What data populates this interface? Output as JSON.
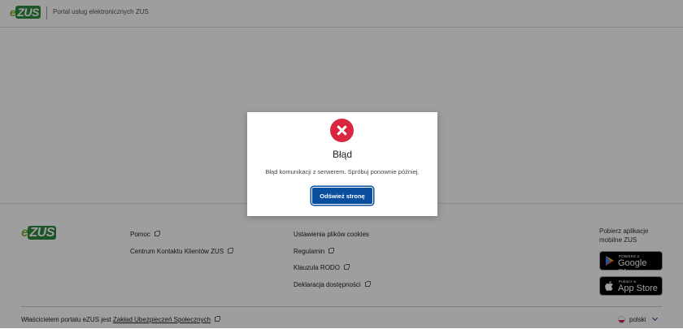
{
  "header": {
    "logo": {
      "e": "e",
      "zus": "ZUS"
    },
    "title": "Portal usług elektronicznych ZUS"
  },
  "footer": {
    "logo": {
      "e": "e",
      "zus": "ZUS"
    },
    "col1": [
      "Pomoc",
      "Centrum Kontaktu Klientów ZUS"
    ],
    "col2": [
      "Ustawienia plików cookies",
      "Regulamin",
      "Klauzula RODO",
      "Deklaracja dostępności"
    ],
    "apps": {
      "title_line1": "Pobierz aplikacje",
      "title_line2": "mobilne ZUS",
      "google": {
        "small": "POBIERZ Z",
        "big": "Google Play"
      },
      "apple": {
        "small": "Pobierz w",
        "big": "App Store"
      }
    },
    "owner_prefix": "Właścicielem portalu eZUS jest ",
    "owner_link": "Zakład Ubezpieczeń Społecznych",
    "language": "polski"
  },
  "modal": {
    "title": "Błąd",
    "message": "Błąd komunikacji z serwerem. Spróbuj ponownie później.",
    "button": "Odśwież stronę"
  },
  "colors": {
    "primary": "#0a4e9e",
    "error": "#d7263d",
    "logo_green": "#2e8b3e",
    "logo_light_green": "#7ab42d"
  }
}
